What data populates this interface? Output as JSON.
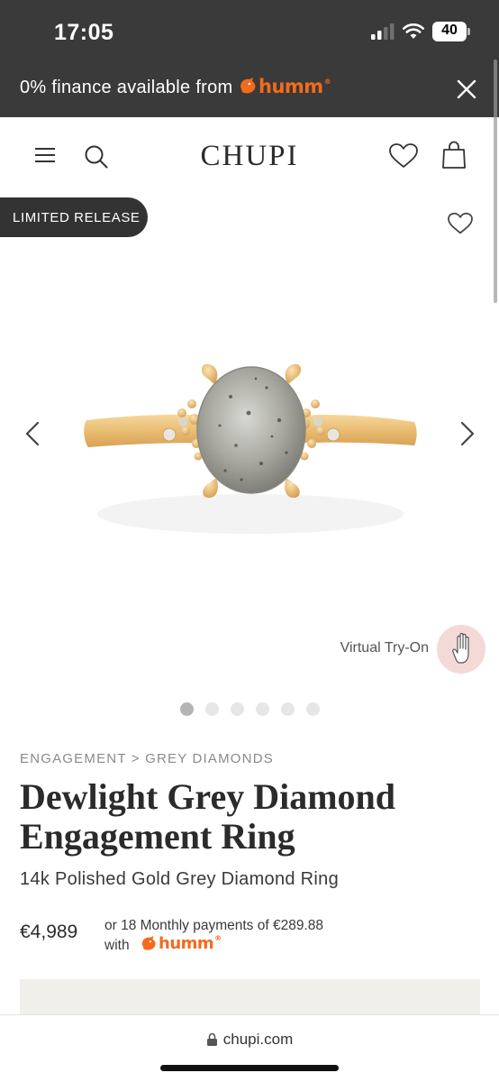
{
  "status_bar": {
    "time": "17:05",
    "battery": "40",
    "icons": [
      "signal-icon",
      "wifi-icon",
      "battery-icon"
    ]
  },
  "finance_banner": {
    "text": "0% finance available from",
    "brand": "humm",
    "brand_mark": "®",
    "close_icon": "close-icon"
  },
  "header": {
    "logo": "CHUPI",
    "icons": [
      "menu-icon",
      "search-icon",
      "wishlist-heart-icon",
      "bag-icon"
    ]
  },
  "product_gallery": {
    "badge": "LIMITED RELEASE",
    "wishlist_icon": "heart-outline-icon",
    "image_alt": "Oval grey diamond ring in yellow gold",
    "virtual_tryon_label": "Virtual Try-On",
    "slide_count": 6,
    "active_slide": 1
  },
  "product": {
    "breadcrumb": "ENGAGEMENT > GREY DIAMONDS",
    "title_line1": "Dewlight Grey Diamond",
    "title_line2": "Engagement Ring",
    "subtitle": "14k Polished Gold Grey Diamond Ring",
    "price": "€4,989",
    "installments_line1": "or 18 Monthly payments of €289.88",
    "installments_line2": "with",
    "installments_brand": "humm"
  },
  "browser": {
    "url": "chupi.com"
  },
  "colors": {
    "banner_bg": "#3a3a3a",
    "brand_orange": "#f26b1d",
    "badge_bg": "#333333",
    "tryon_bg": "#f4d9d7",
    "promo_bg": "#f1efeb"
  }
}
